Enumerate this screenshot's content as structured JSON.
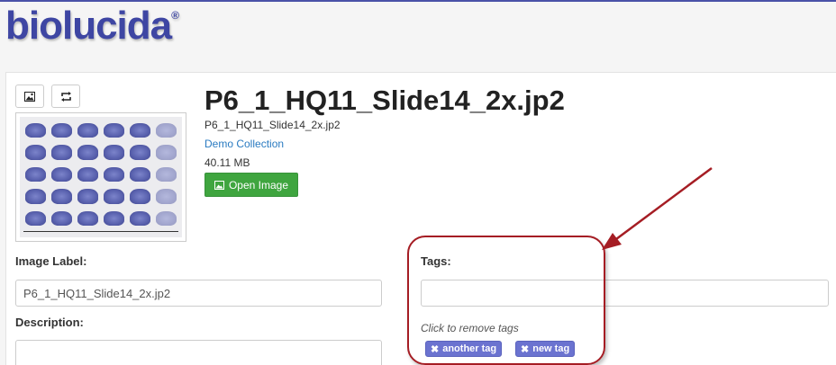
{
  "app": {
    "logo": "biolucida",
    "logo_mark": "®"
  },
  "toolbar": {
    "image_icon": "image-icon",
    "rotate_icon": "rotate-icon"
  },
  "image": {
    "title": "P6_1_HQ11_Slide14_2x.jp2",
    "filename": "P6_1_HQ11_Slide14_2x.jp2",
    "collection": "Demo Collection",
    "size": "40.11 MB",
    "open_label": "Open Image"
  },
  "form": {
    "label_heading": "Image Label:",
    "label_value": "P6_1_HQ11_Slide14_2x.jp2",
    "description_heading": "Description:",
    "description_value": "",
    "tags_heading": "Tags:",
    "tags_input_value": "",
    "tags_hint": "Click to remove tags",
    "tags": [
      "another tag",
      "new tag"
    ]
  },
  "colors": {
    "brand": "#3e46a3",
    "open_button": "#3fa53f",
    "tag": "#6b73d0",
    "annotation": "#a51d24"
  }
}
